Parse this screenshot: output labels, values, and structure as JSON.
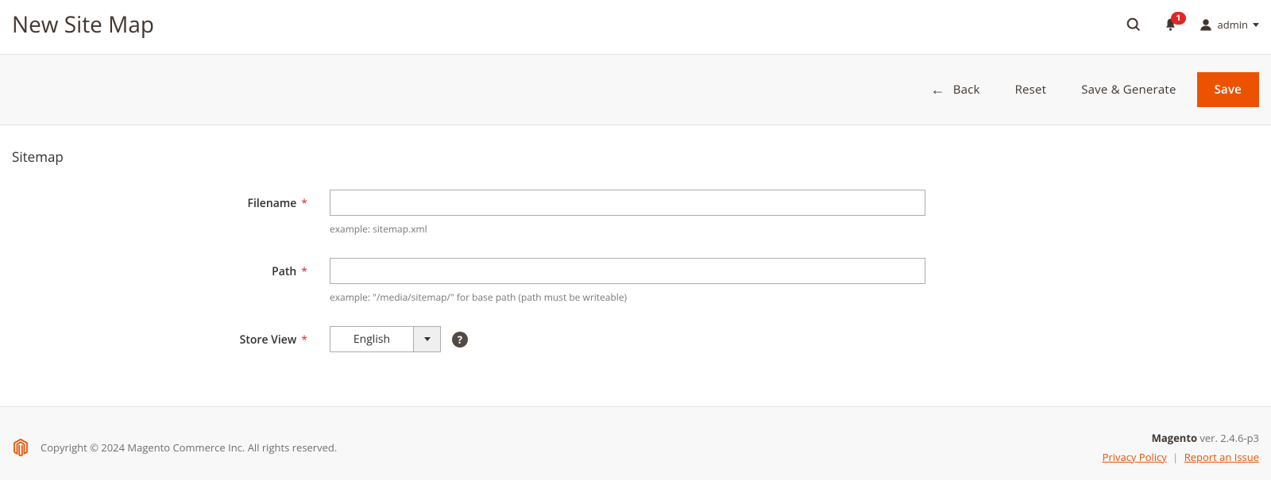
{
  "header": {
    "page_title": "New Site Map",
    "notifications_count": "1",
    "user_name": "admin"
  },
  "actions": {
    "back": "Back",
    "reset": "Reset",
    "save_generate": "Save & Generate",
    "save": "Save"
  },
  "form": {
    "section_title": "Sitemap",
    "filename": {
      "label": "Filename",
      "value": "",
      "note": "example: sitemap.xml"
    },
    "path": {
      "label": "Path",
      "value": "",
      "note": "example: \"/media/sitemap/\" for base path (path must be writeable)"
    },
    "store_view": {
      "label": "Store View",
      "selected": "English"
    }
  },
  "footer": {
    "copyright": "Copyright © 2024 Magento Commerce Inc. All rights reserved.",
    "brand": "Magento",
    "version": " ver. 2.4.6-p3",
    "privacy": "Privacy Policy",
    "report": "Report an Issue"
  }
}
